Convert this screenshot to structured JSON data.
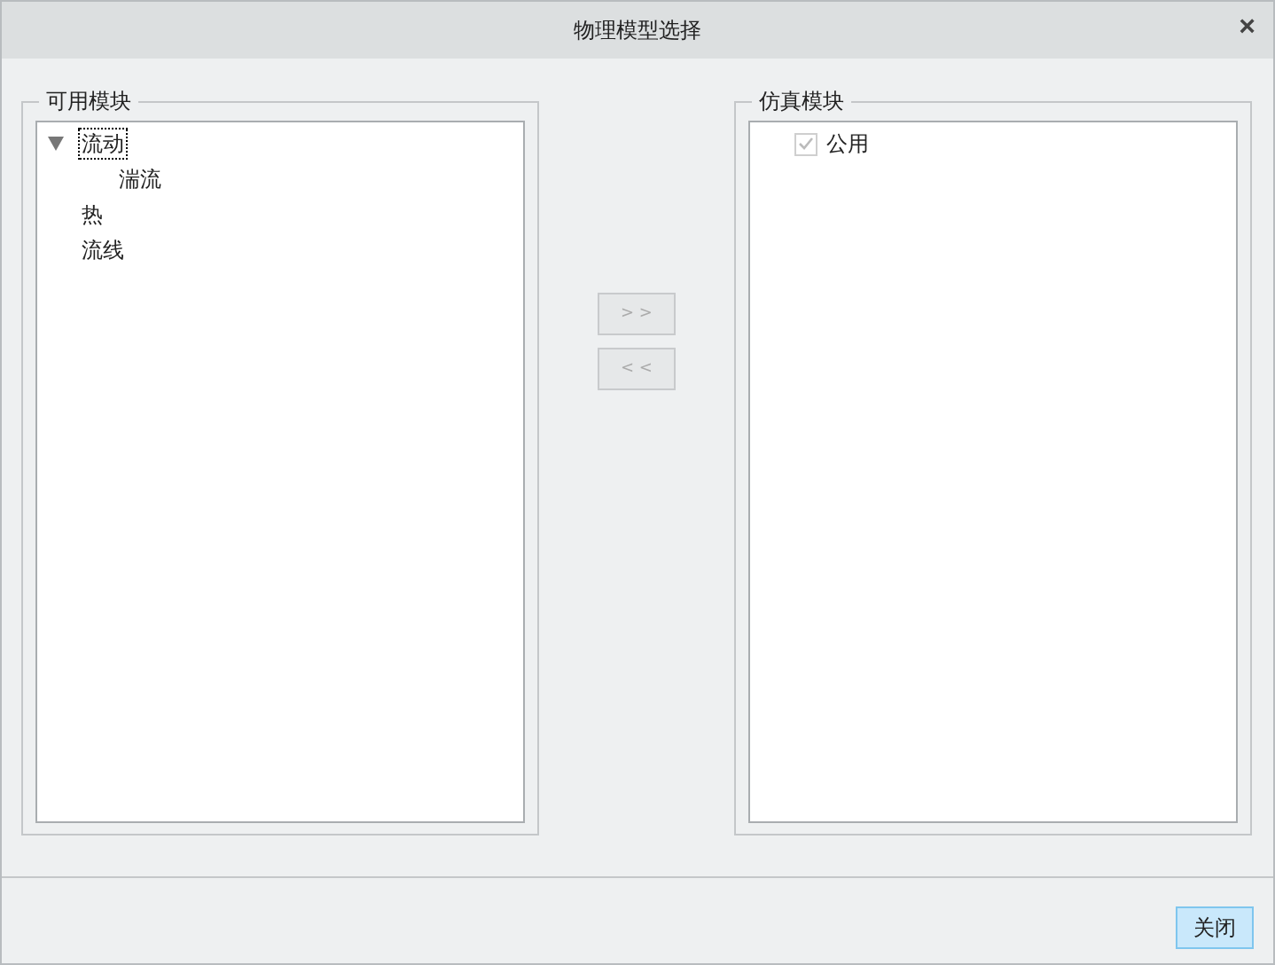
{
  "window": {
    "title": "物理模型选择",
    "close": "×"
  },
  "available": {
    "title": "可用模块",
    "items": [
      {
        "label": "流动",
        "selected": true,
        "expanded": true,
        "children": [
          {
            "label": "湍流",
            "selected": false
          }
        ]
      },
      {
        "label": "热",
        "selected": false
      },
      {
        "label": "流线",
        "selected": false
      }
    ]
  },
  "transfer_buttons": [
    {
      "label": "> >",
      "disabled": true
    },
    {
      "label": "< <",
      "disabled": true
    }
  ],
  "simulation": {
    "title": "仿真模块",
    "items": [
      {
        "label": "公用",
        "checked": true,
        "disabled": true
      }
    ]
  },
  "footer_buttons": [
    {
      "label": "关闭",
      "selected": true
    }
  ]
}
